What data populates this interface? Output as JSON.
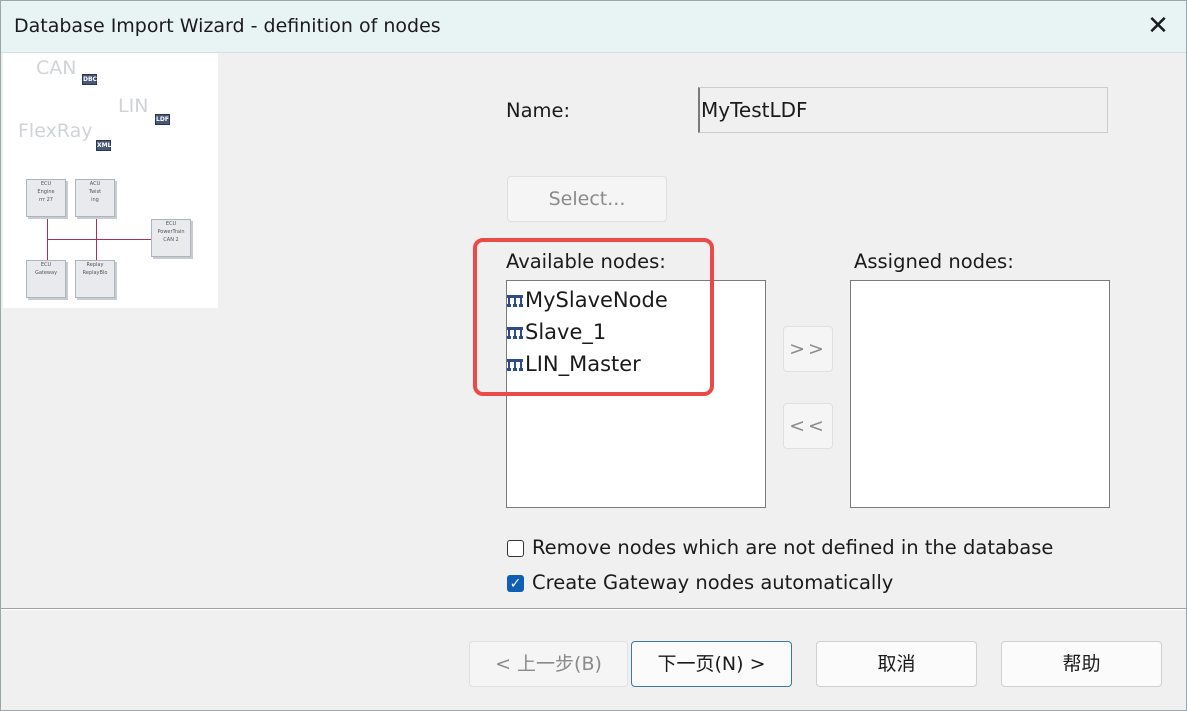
{
  "window": {
    "title": "Database Import Wizard - definition of nodes",
    "close_glyph": "✕"
  },
  "illustration": {
    "buses": [
      {
        "label": "CAN",
        "badge": "DBC"
      },
      {
        "label": "LIN",
        "badge": "LDF"
      },
      {
        "label": "FlexRay",
        "badge": "XML"
      }
    ],
    "ecus": [
      {
        "line1": "ECU",
        "line2": "Engine",
        "line3": "rrr 27"
      },
      {
        "line1": "ACU",
        "line2": "Twist",
        "line3": "ing"
      },
      {
        "line1": "ECU",
        "line2": "PowerTrain",
        "line3": "CAN 2"
      },
      {
        "line1": "ECU",
        "line2": "Gateway",
        "line3": ""
      },
      {
        "line1": "Replay",
        "line2": "ReplayBlo",
        "line3": ""
      }
    ],
    "accent_color": "#a33060"
  },
  "form": {
    "name_label": "Name:",
    "name_value": "MyTestLDF",
    "select_button": "Select...",
    "available_label": "Available nodes:",
    "assigned_label": "Assigned nodes:",
    "available_nodes": [
      {
        "label": "MySlaveNode",
        "icon": "network-node-icon"
      },
      {
        "label": "Slave_1",
        "icon": "network-node-icon"
      },
      {
        "label": "LIN_Master",
        "icon": "network-node-icon"
      }
    ],
    "assigned_nodes": [],
    "move_right": ">>",
    "move_left": "<<",
    "options": [
      {
        "label": "Remove nodes which are not defined in the database",
        "checked": false
      },
      {
        "label": "Create Gateway nodes automatically",
        "checked": true
      }
    ]
  },
  "footer": {
    "back_button": "< 上一步(B)",
    "next_button": "下一页(N) >",
    "cancel_button": "取消",
    "help_button": "帮助"
  },
  "colors": {
    "highlight": "#ea4b49",
    "checkbox_checked": "#0f5fb7",
    "titlebar": "#e8f4f4"
  }
}
